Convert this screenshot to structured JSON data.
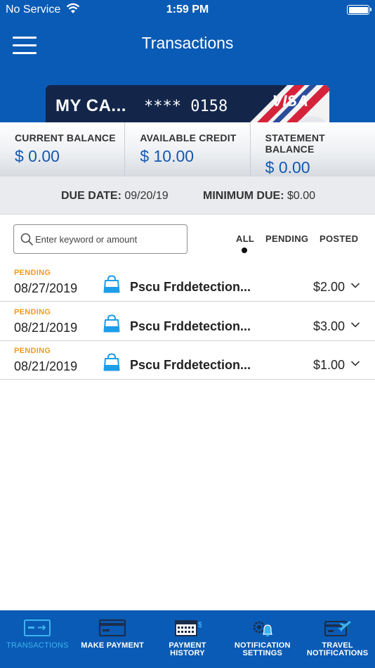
{
  "status_bar": {
    "carrier": "No Service",
    "time": "1:59 PM"
  },
  "header": {
    "title": "Transactions"
  },
  "card": {
    "name": "MY CA...",
    "number": "**** 0158",
    "brand": "VISA"
  },
  "balances": [
    {
      "label": "CURRENT BALANCE",
      "value": "$ 0.00"
    },
    {
      "label": "AVAILABLE CREDIT",
      "value": "$ 10.00"
    },
    {
      "label": "STATEMENT BALANCE",
      "value": "$ 0.00"
    }
  ],
  "due": {
    "due_date_label": "DUE DATE:",
    "due_date_value": "09/20/19",
    "minimum_due_label": "MINIMUM DUE:",
    "minimum_due_value": "$0.00"
  },
  "search": {
    "placeholder": "Enter keyword or amount",
    "value": ""
  },
  "filters": {
    "all": "ALL",
    "pending": "PENDING",
    "posted": "POSTED",
    "selected": "ALL"
  },
  "transactions": [
    {
      "status": "PENDING",
      "date": "08/27/2019",
      "merchant": "Pscu Frddetection...",
      "amount": "$2.00"
    },
    {
      "status": "PENDING",
      "date": "08/21/2019",
      "merchant": "Pscu Frddetection...",
      "amount": "$3.00"
    },
    {
      "status": "PENDING",
      "date": "08/21/2019",
      "merchant": "Pscu Frddetection...",
      "amount": "$1.00"
    }
  ],
  "bottom_nav": [
    {
      "label": "TRANSACTIONS",
      "icon": "transactions-card-icon",
      "active": true
    },
    {
      "label": "MAKE PAYMENT",
      "icon": "payment-card-icon",
      "active": false
    },
    {
      "label_line1": "PAYMENT",
      "label_line2": "HISTORY",
      "icon": "calendar-dollar-icon",
      "active": false
    },
    {
      "label_line1": "NOTIFICATION",
      "label_line2": "SETTINGS",
      "icon": "gear-bell-icon",
      "active": false
    },
    {
      "label_line1": "TRAVEL",
      "label_line2": "NOTIFICATIONS",
      "icon": "card-airplane-icon",
      "active": false
    }
  ],
  "colors": {
    "brand_blue": "#0a5bb5",
    "balance_blue": "#1558b0",
    "pending_orange": "#f39a1e",
    "active_nav": "#3db2f0",
    "bag_icon": "#1d9ee8"
  }
}
